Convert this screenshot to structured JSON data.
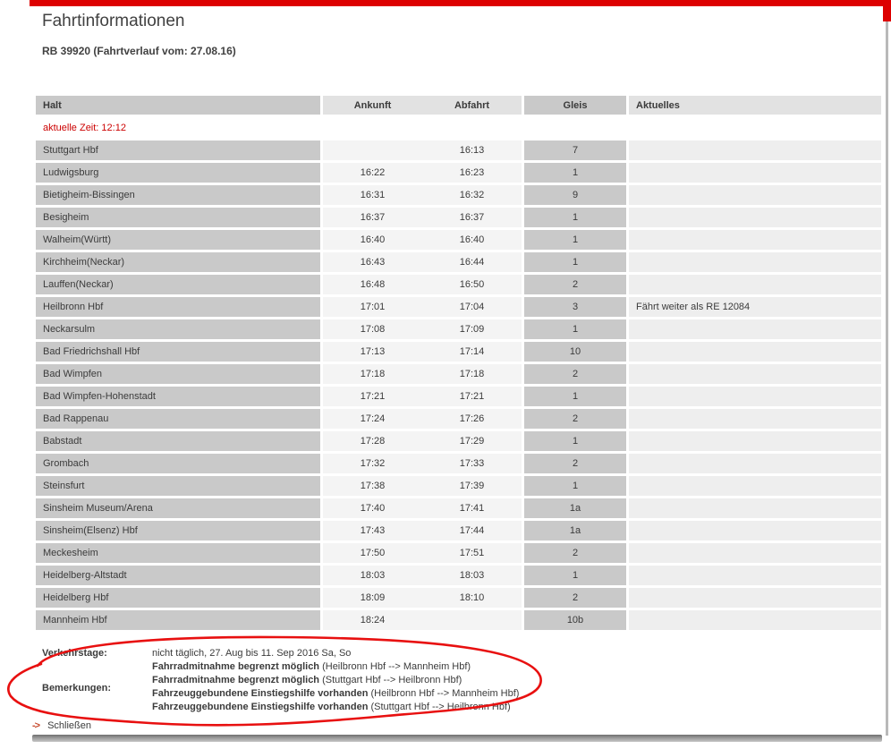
{
  "window": {
    "title": "Fahrtinformationen",
    "subtitle": "RB 39920 (Fahrtverlauf vom: 27.08.16)",
    "current_time": "aktuelle Zeit: 12:12",
    "accent_red": "#dd0000",
    "annotation_red": "#e81010"
  },
  "table": {
    "headers": {
      "halt": "Halt",
      "ankunft": "Ankunft",
      "abfahrt": "Abfahrt",
      "gleis": "Gleis",
      "aktuelles": "Aktuelles"
    },
    "rows": [
      {
        "halt": "Stuttgart Hbf",
        "ankunft": "",
        "abfahrt": "16:13",
        "gleis": "7",
        "aktuelles": ""
      },
      {
        "halt": "Ludwigsburg",
        "ankunft": "16:22",
        "abfahrt": "16:23",
        "gleis": "1",
        "aktuelles": ""
      },
      {
        "halt": "Bietigheim-Bissingen",
        "ankunft": "16:31",
        "abfahrt": "16:32",
        "gleis": "9",
        "aktuelles": ""
      },
      {
        "halt": "Besigheim",
        "ankunft": "16:37",
        "abfahrt": "16:37",
        "gleis": "1",
        "aktuelles": ""
      },
      {
        "halt": "Walheim(Württ)",
        "ankunft": "16:40",
        "abfahrt": "16:40",
        "gleis": "1",
        "aktuelles": ""
      },
      {
        "halt": "Kirchheim(Neckar)",
        "ankunft": "16:43",
        "abfahrt": "16:44",
        "gleis": "1",
        "aktuelles": ""
      },
      {
        "halt": "Lauffen(Neckar)",
        "ankunft": "16:48",
        "abfahrt": "16:50",
        "gleis": "2",
        "aktuelles": ""
      },
      {
        "halt": "Heilbronn Hbf",
        "ankunft": "17:01",
        "abfahrt": "17:04",
        "gleis": "3",
        "aktuelles": "Fährt weiter als RE 12084"
      },
      {
        "halt": "Neckarsulm",
        "ankunft": "17:08",
        "abfahrt": "17:09",
        "gleis": "1",
        "aktuelles": ""
      },
      {
        "halt": "Bad Friedrichshall Hbf",
        "ankunft": "17:13",
        "abfahrt": "17:14",
        "gleis": "10",
        "aktuelles": ""
      },
      {
        "halt": "Bad Wimpfen",
        "ankunft": "17:18",
        "abfahrt": "17:18",
        "gleis": "2",
        "aktuelles": ""
      },
      {
        "halt": "Bad Wimpfen-Hohenstadt",
        "ankunft": "17:21",
        "abfahrt": "17:21",
        "gleis": "1",
        "aktuelles": ""
      },
      {
        "halt": "Bad Rappenau",
        "ankunft": "17:24",
        "abfahrt": "17:26",
        "gleis": "2",
        "aktuelles": ""
      },
      {
        "halt": "Babstadt",
        "ankunft": "17:28",
        "abfahrt": "17:29",
        "gleis": "1",
        "aktuelles": ""
      },
      {
        "halt": "Grombach",
        "ankunft": "17:32",
        "abfahrt": "17:33",
        "gleis": "2",
        "aktuelles": ""
      },
      {
        "halt": "Steinsfurt",
        "ankunft": "17:38",
        "abfahrt": "17:39",
        "gleis": "1",
        "aktuelles": ""
      },
      {
        "halt": "Sinsheim Museum/Arena",
        "ankunft": "17:40",
        "abfahrt": "17:41",
        "gleis": "1a",
        "aktuelles": ""
      },
      {
        "halt": "Sinsheim(Elsenz) Hbf",
        "ankunft": "17:43",
        "abfahrt": "17:44",
        "gleis": "1a",
        "aktuelles": ""
      },
      {
        "halt": "Meckesheim",
        "ankunft": "17:50",
        "abfahrt": "17:51",
        "gleis": "2",
        "aktuelles": ""
      },
      {
        "halt": "Heidelberg-Altstadt",
        "ankunft": "18:03",
        "abfahrt": "18:03",
        "gleis": "1",
        "aktuelles": ""
      },
      {
        "halt": "Heidelberg Hbf",
        "ankunft": "18:09",
        "abfahrt": "18:10",
        "gleis": "2",
        "aktuelles": ""
      },
      {
        "halt": "Mannheim Hbf",
        "ankunft": "18:24",
        "abfahrt": "",
        "gleis": "10b",
        "aktuelles": ""
      }
    ]
  },
  "footer": {
    "verkehrstage_label": "Verkehrstage:",
    "verkehrstage_value": "nicht täglich, 27. Aug bis 11. Sep 2016 Sa, So",
    "bemerkungen_label": "Bemerkungen:",
    "bemerkungen": [
      {
        "bold": "Fahrradmitnahme begrenzt möglich",
        "normal": " (Heilbronn Hbf --> Mannheim Hbf)"
      },
      {
        "bold": "Fahrradmitnahme begrenzt möglich",
        "normal": " (Stuttgart Hbf --> Heilbronn Hbf)"
      },
      {
        "bold": "Fahrzeuggebundene Einstiegshilfe vorhanden",
        "normal": " (Heilbronn Hbf --> Mannheim Hbf)"
      },
      {
        "bold": "Fahrzeuggebundene Einstiegshilfe vorhanden",
        "normal": " (Stuttgart Hbf --> Heilbronn Hbf)"
      }
    ],
    "close_label": "Schließen",
    "close_arrow": "->"
  }
}
